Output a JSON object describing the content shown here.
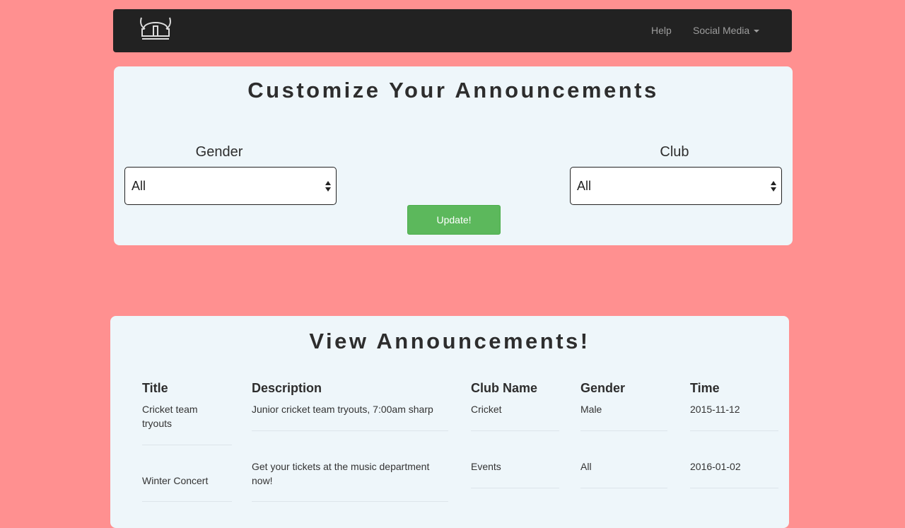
{
  "navbar": {
    "logo_icon": "viking-helmet-icon",
    "help_label": "Help",
    "social_label": "Social Media",
    "background": "#222222"
  },
  "customize": {
    "title": "Customize Your Announcements",
    "gender_label": "Gender",
    "gender_value": "All",
    "club_label": "Club",
    "club_value": "All",
    "update_label": "Update!",
    "update_color": "#5cb85c"
  },
  "view": {
    "title": "View Announcements!",
    "columns": [
      "Title",
      "Description",
      "Club Name",
      "Gender",
      "Time"
    ],
    "rows": [
      {
        "title": "Cricket team tryouts",
        "description": "Junior cricket team tryouts, 7:00am sharp",
        "club": "Cricket",
        "gender": "Male",
        "time": "2015-11-12"
      },
      {
        "title": "Winter Concert",
        "description": "Get your tickets at the music department now!",
        "club": "Events",
        "gender": "All",
        "time": "2016-01-02"
      }
    ]
  },
  "colors": {
    "page_background": "#ff9090",
    "panel_background": "#eef6fa"
  }
}
